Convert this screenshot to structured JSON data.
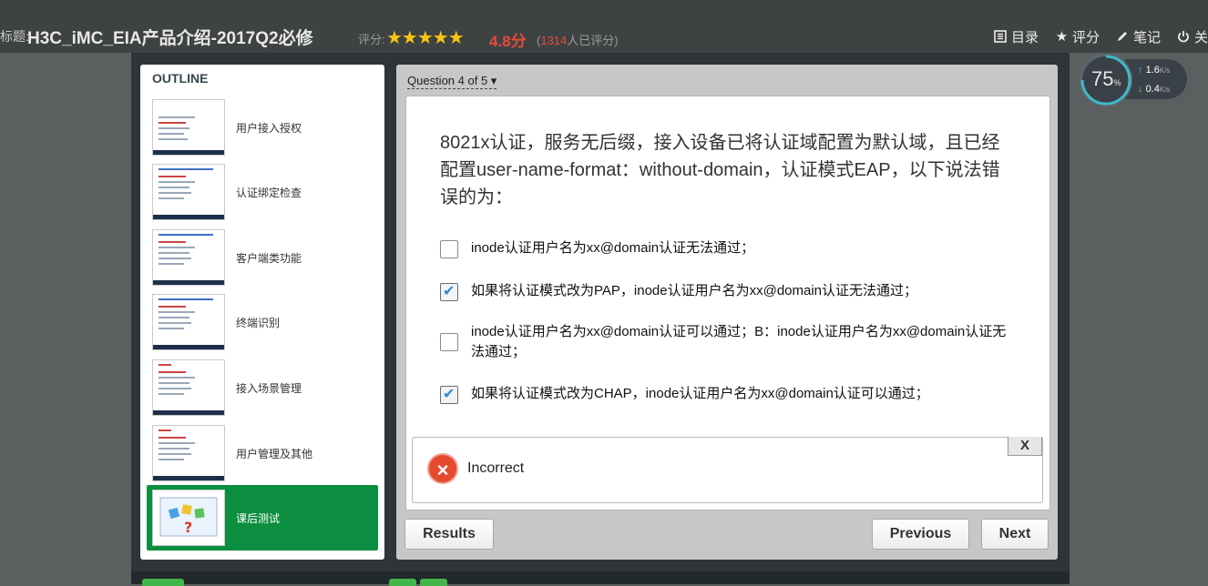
{
  "topbar": {
    "title_prefix": "标题:",
    "course_title": "H3C_iMC_EIA产品介绍-2017Q2必修",
    "rating_label": "评分:",
    "stars": "★★★★★",
    "score": "4.8分",
    "count_prefix": "(",
    "count": "1314",
    "count_suffix": "人已评分)",
    "links": [
      {
        "icon": "list-icon",
        "label": "目录"
      },
      {
        "icon": "star-icon",
        "label": "评分"
      },
      {
        "icon": "pencil-icon",
        "label": "笔记"
      },
      {
        "icon": "power-icon",
        "label": "关"
      }
    ]
  },
  "gauge": {
    "percent": "75",
    "percent_unit": "%",
    "upload": "1.6",
    "download": "0.4",
    "unit": "K/s"
  },
  "outline": {
    "heading": "OUTLINE",
    "slides": [
      {
        "label": "用户接入授权"
      },
      {
        "label": "认证绑定检查"
      },
      {
        "label": "客户端类功能"
      },
      {
        "label": "终端识别"
      },
      {
        "label": "接入场景管理"
      },
      {
        "label": "用户管理及其他"
      },
      {
        "label": "课后测试",
        "active": true
      }
    ]
  },
  "quiz": {
    "nav": "Question 4 of 5",
    "question": "8021x认证，服务无后缀，接入设备已将认证域配置为默认域，且已经配置user-name-format：without-domain，认证模式EAP，以下说法错误的为：",
    "options": [
      {
        "text": "inode认证用户名为xx@domain认证无法通过；",
        "checked": false
      },
      {
        "text": "如果将认证模式改为PAP，inode认证用户名为xx@domain认证无法通过；",
        "checked": true
      },
      {
        "text": "inode认证用户名为xx@domain认证可以通过；B：inode认证用户名为xx@domain认证无法通过；",
        "checked": false
      },
      {
        "text": "如果将认证模式改为CHAP，inode认证用户名为xx@domain认证可以通过；",
        "checked": true
      }
    ],
    "feedback": {
      "close": "X",
      "status": "Incorrect"
    },
    "buttons": {
      "results": "Results",
      "previous": "Previous",
      "next": "Next"
    }
  }
}
